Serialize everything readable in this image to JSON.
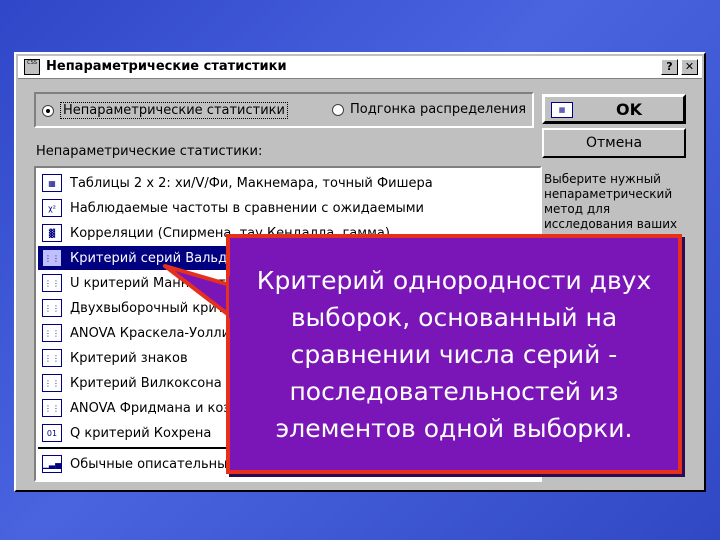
{
  "window": {
    "title": "Непараметрические статистики",
    "help_button": "?",
    "close_button": "✕",
    "sysmenu_icon": "CSS"
  },
  "modes": [
    {
      "label": "Непараметрические статистики",
      "selected": true
    },
    {
      "label": "Подгонка распределения",
      "selected": false
    }
  ],
  "section_label": "Непараметрические статистики:",
  "methods": [
    {
      "label": "Таблицы 2 x 2:  хи/V/Фи, Макнемара, точный Фишера",
      "icon": "table-icon"
    },
    {
      "label": "Наблюдаемые частоты в сравнении с ожидаемыми",
      "icon": "chi-icon"
    },
    {
      "label": "Корреляции (Спирмена, тау Кендалла, гамма)",
      "icon": "grid-icon"
    },
    {
      "label": "Критерий серий Вальда-Вольфовица",
      "icon": "runs-icon",
      "selected": true
    },
    {
      "label": "U критерий Манна-Уитни",
      "icon": "runs-icon"
    },
    {
      "label": "Двухвыборочный критерий Колмогорова-Смирнова",
      "icon": "runs-icon"
    },
    {
      "label": "ANOVA Краскела-Уоллиса и медианный тест",
      "icon": "runs-icon"
    },
    {
      "label": "Критерий знаков",
      "icon": "runs-icon"
    },
    {
      "label": "Критерий Вилкоксона",
      "icon": "runs-icon"
    },
    {
      "label": "ANOVA Фридмана и коэффициент конкордации Кендалла",
      "icon": "runs-icon"
    },
    {
      "label": "Q критерий Кохрена",
      "icon": "binary-icon"
    },
    {
      "label": "Обычные описательные статистики",
      "icon": "chart-icon"
    }
  ],
  "buttons": {
    "ok": "OK",
    "cancel": "Отмена"
  },
  "help_text": "Выберите нужный непараметрический метод для исследования ваших",
  "callout": {
    "text": "Критерий однородности двух выборок, основанный на сравнении числа серий - последовательностей из элементов одной выборки."
  },
  "colors": {
    "background": "#3a55d4",
    "selection": "#000080",
    "callout_fill": "#7a16b8",
    "callout_border": "#e6301e"
  }
}
